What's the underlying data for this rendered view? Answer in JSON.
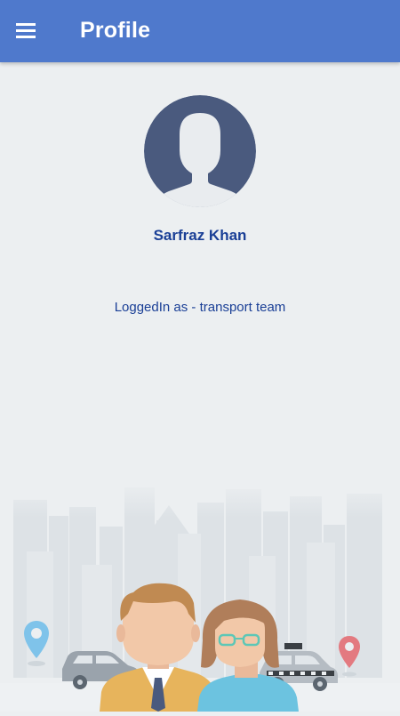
{
  "appbar": {
    "title": "Profile",
    "menu_icon": "hamburger-menu-icon",
    "color": "#4F79CC"
  },
  "profile": {
    "avatar_icon": "default-user-avatar-icon",
    "name": "Sarfraz Khan",
    "logged_in_text": "LoggedIn as - transport team"
  },
  "illustration": {
    "name": "city-transport-illustration"
  },
  "colors": {
    "background": "#ECEFF1",
    "text_accent": "#1A3F96",
    "avatar": "#4A5A7E"
  }
}
